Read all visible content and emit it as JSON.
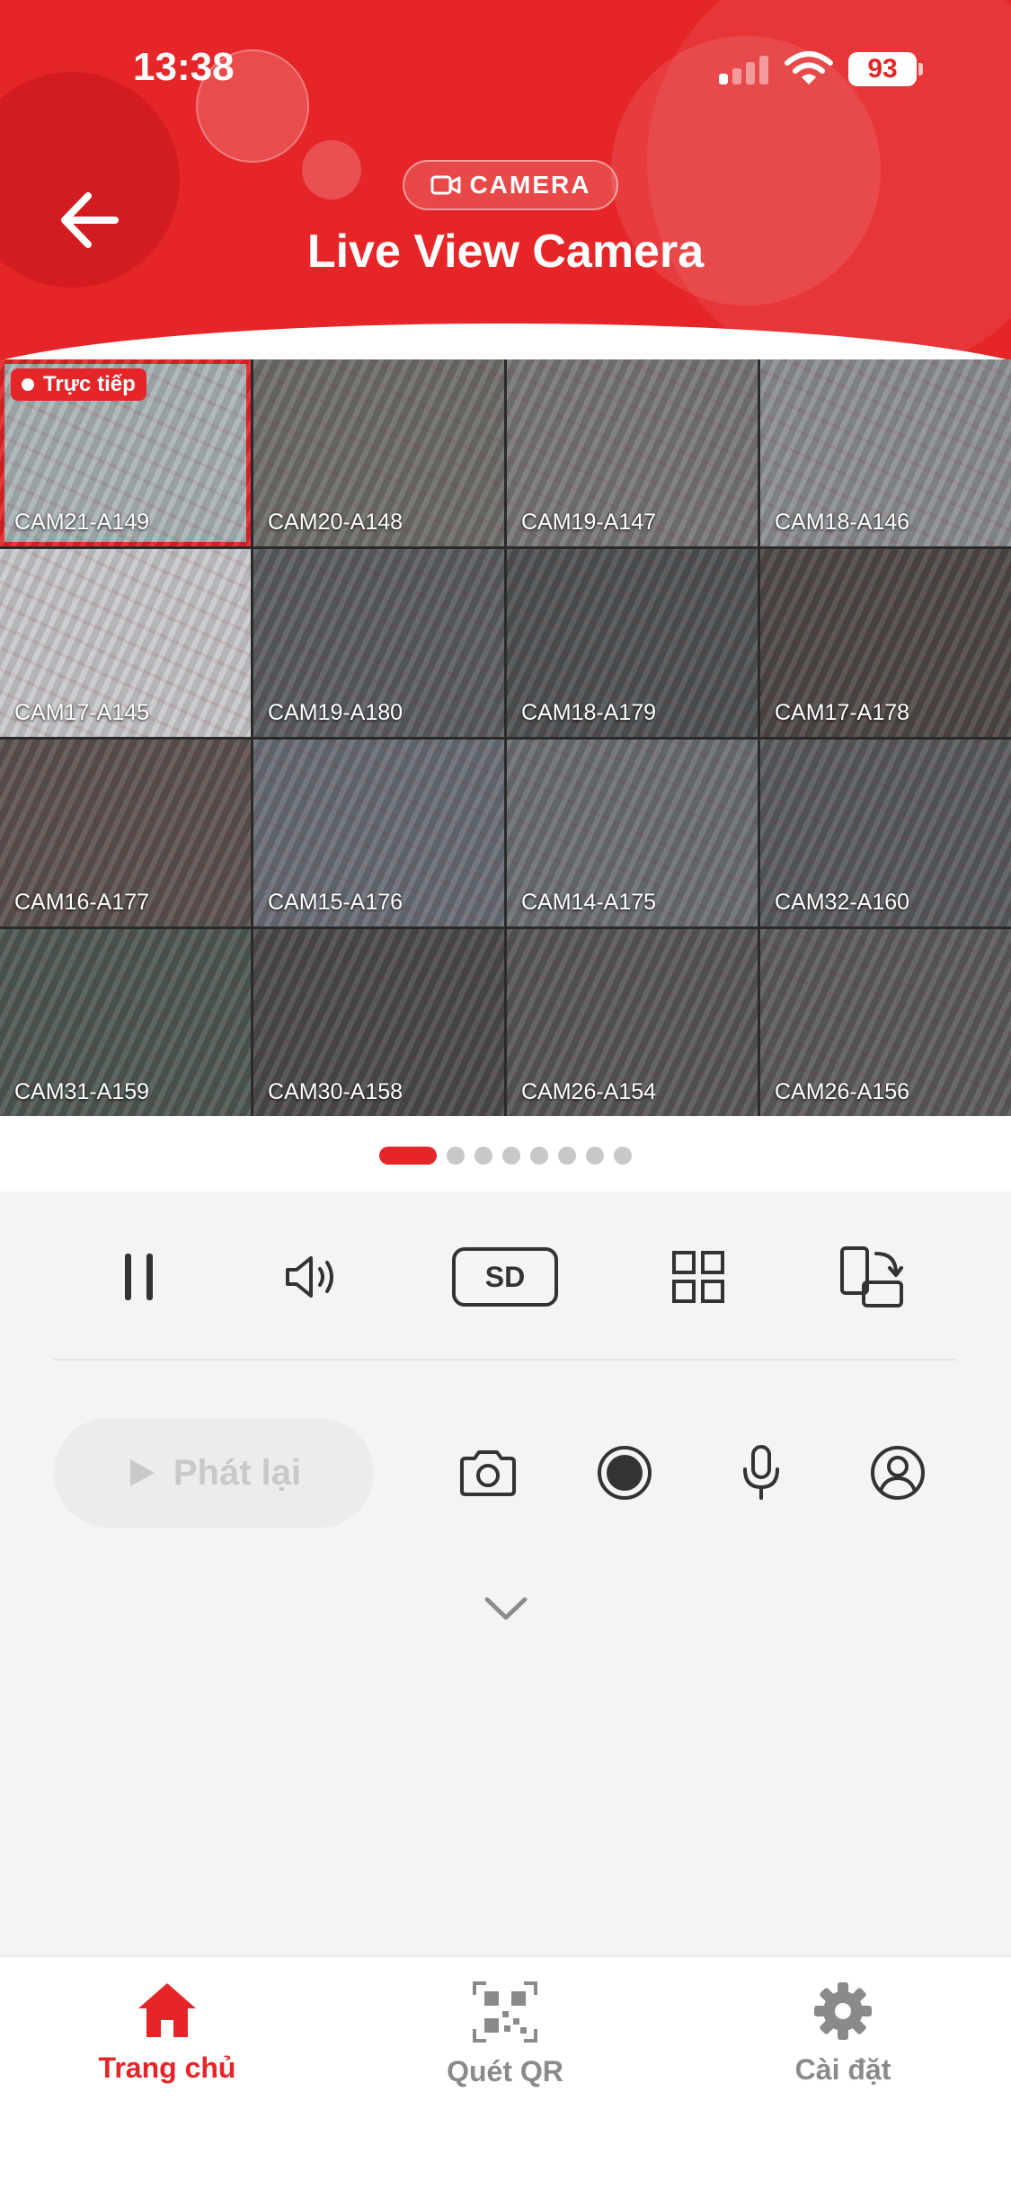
{
  "status_bar": {
    "time": "13:38",
    "battery": "93"
  },
  "header": {
    "chip_label": "CAMERA",
    "title": "Live View Camera"
  },
  "grid": {
    "live_badge": "Trực tiếp",
    "cameras": [
      {
        "label": "CAM21-A149",
        "bg": "#a9b3b6",
        "selected": true
      },
      {
        "label": "CAM20-A148",
        "bg": "#6e6e6a"
      },
      {
        "label": "CAM19-A147",
        "bg": "#77777a"
      },
      {
        "label": "CAM18-A146",
        "bg": "#8b8f93"
      },
      {
        "label": "CAM17-A145",
        "bg": "#c7c9cc"
      },
      {
        "label": "CAM19-A180",
        "bg": "#5a5e63"
      },
      {
        "label": "CAM18-A179",
        "bg": "#4f5355"
      },
      {
        "label": "CAM17-A178",
        "bg": "#4e4a48"
      },
      {
        "label": "CAM16-A177",
        "bg": "#5b5450"
      },
      {
        "label": "CAM15-A176",
        "bg": "#686e76"
      },
      {
        "label": "CAM14-A175",
        "bg": "#6b7075"
      },
      {
        "label": "CAM32-A160",
        "bg": "#595c60"
      },
      {
        "label": "CAM31-A159",
        "bg": "#4e5a54"
      },
      {
        "label": "CAM30-A158",
        "bg": "#4a4c4e"
      },
      {
        "label": "CAM26-A154",
        "bg": "#56585a"
      },
      {
        "label": "CAM26-A156",
        "bg": "#5a5c5e"
      }
    ]
  },
  "pager": {
    "total": 8,
    "active": 0
  },
  "controls": {
    "quality_label": "SD",
    "replay_label": "Phát lại"
  },
  "bottom_nav": {
    "home": "Trang chủ",
    "qr": "Quét QR",
    "settings": "Cài đặt"
  },
  "colors": {
    "accent": "#e52527",
    "icon": "#333333",
    "muted": "#8a8a8a"
  }
}
